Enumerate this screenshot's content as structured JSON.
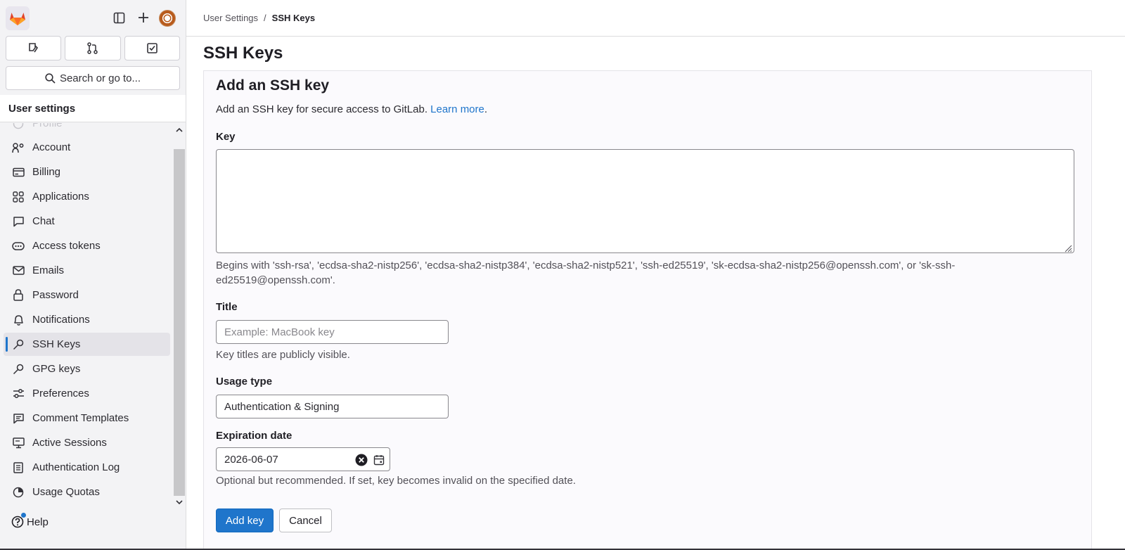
{
  "sidebar": {
    "search_label": "Search or go to...",
    "header": "User settings",
    "items": [
      {
        "label": "Profile",
        "icon": "profile-icon"
      },
      {
        "label": "Account",
        "icon": "account-icon"
      },
      {
        "label": "Billing",
        "icon": "billing-icon"
      },
      {
        "label": "Applications",
        "icon": "applications-icon"
      },
      {
        "label": "Chat",
        "icon": "chat-icon"
      },
      {
        "label": "Access tokens",
        "icon": "token-icon"
      },
      {
        "label": "Emails",
        "icon": "mail-icon"
      },
      {
        "label": "Password",
        "icon": "lock-icon"
      },
      {
        "label": "Notifications",
        "icon": "bell-icon"
      },
      {
        "label": "SSH Keys",
        "icon": "key-icon"
      },
      {
        "label": "GPG keys",
        "icon": "key-icon"
      },
      {
        "label": "Preferences",
        "icon": "preferences-icon"
      },
      {
        "label": "Comment Templates",
        "icon": "comment-icon"
      },
      {
        "label": "Active Sessions",
        "icon": "monitor-icon"
      },
      {
        "label": "Authentication Log",
        "icon": "log-icon"
      },
      {
        "label": "Usage Quotas",
        "icon": "quota-icon"
      }
    ],
    "active_item": "SSH Keys",
    "help_label": "Help"
  },
  "breadcrumb": {
    "parent": "User Settings",
    "separator": "/",
    "current": "SSH Keys"
  },
  "page": {
    "title": "SSH Keys"
  },
  "form": {
    "title": "Add an SSH key",
    "description": "Add an SSH key for secure access to GitLab.",
    "learn_more": "Learn more",
    "period": ".",
    "key_label": "Key",
    "key_value": "",
    "key_help": "Begins with 'ssh-rsa', 'ecdsa-sha2-nistp256', 'ecdsa-sha2-nistp384', 'ecdsa-sha2-nistp521', 'ssh-ed25519', 'sk-ecdsa-sha2-nistp256@openssh.com', or 'sk-ssh-ed25519@openssh.com'.",
    "title_label": "Title",
    "title_placeholder": "Example: MacBook key",
    "title_help": "Key titles are publicly visible.",
    "usage_label": "Usage type",
    "usage_value": "Authentication & Signing",
    "expiration_label": "Expiration date",
    "expiration_value": "2026-06-07",
    "expiration_help": "Optional but recommended. If set, key becomes invalid on the specified date.",
    "submit_label": "Add key",
    "cancel_label": "Cancel"
  },
  "colors": {
    "accent": "#1f75cb",
    "logo": "#e24329"
  }
}
